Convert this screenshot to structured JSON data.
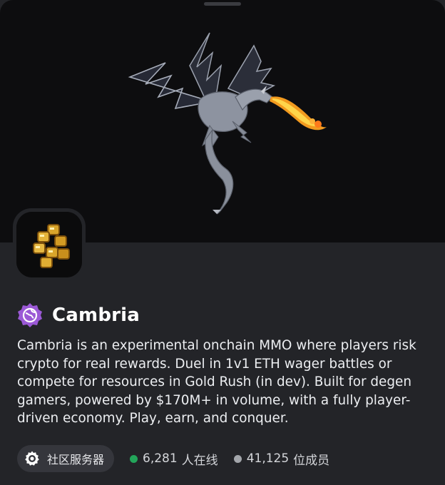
{
  "server": {
    "name": "Cambria",
    "description": "Cambria is an experimental onchain MMO where players risk crypto for real rewards. Duel in 1v1 ETH wager battles or compete for resources in Gold Rush (in dev). Built for degen gamers, powered by $170M+ in volume, with a fully player-driven economy. Play, earn, and conquer."
  },
  "tag": {
    "label": "社区服务器",
    "icon": "gear-icon"
  },
  "stats": {
    "online_count": "6,281",
    "online_label": "人在线",
    "members_count": "41,125",
    "members_label": "位成员"
  },
  "colors": {
    "background": "#232428",
    "banner": "#0d0d0f",
    "online_dot": "#23a55a",
    "members_dot": "#a3a6ab",
    "badge": "#9b59d6"
  },
  "icons": {
    "banner": "dragon-illustration",
    "server": "gold-coins-icon",
    "badge": "discoverable-badge-icon"
  }
}
